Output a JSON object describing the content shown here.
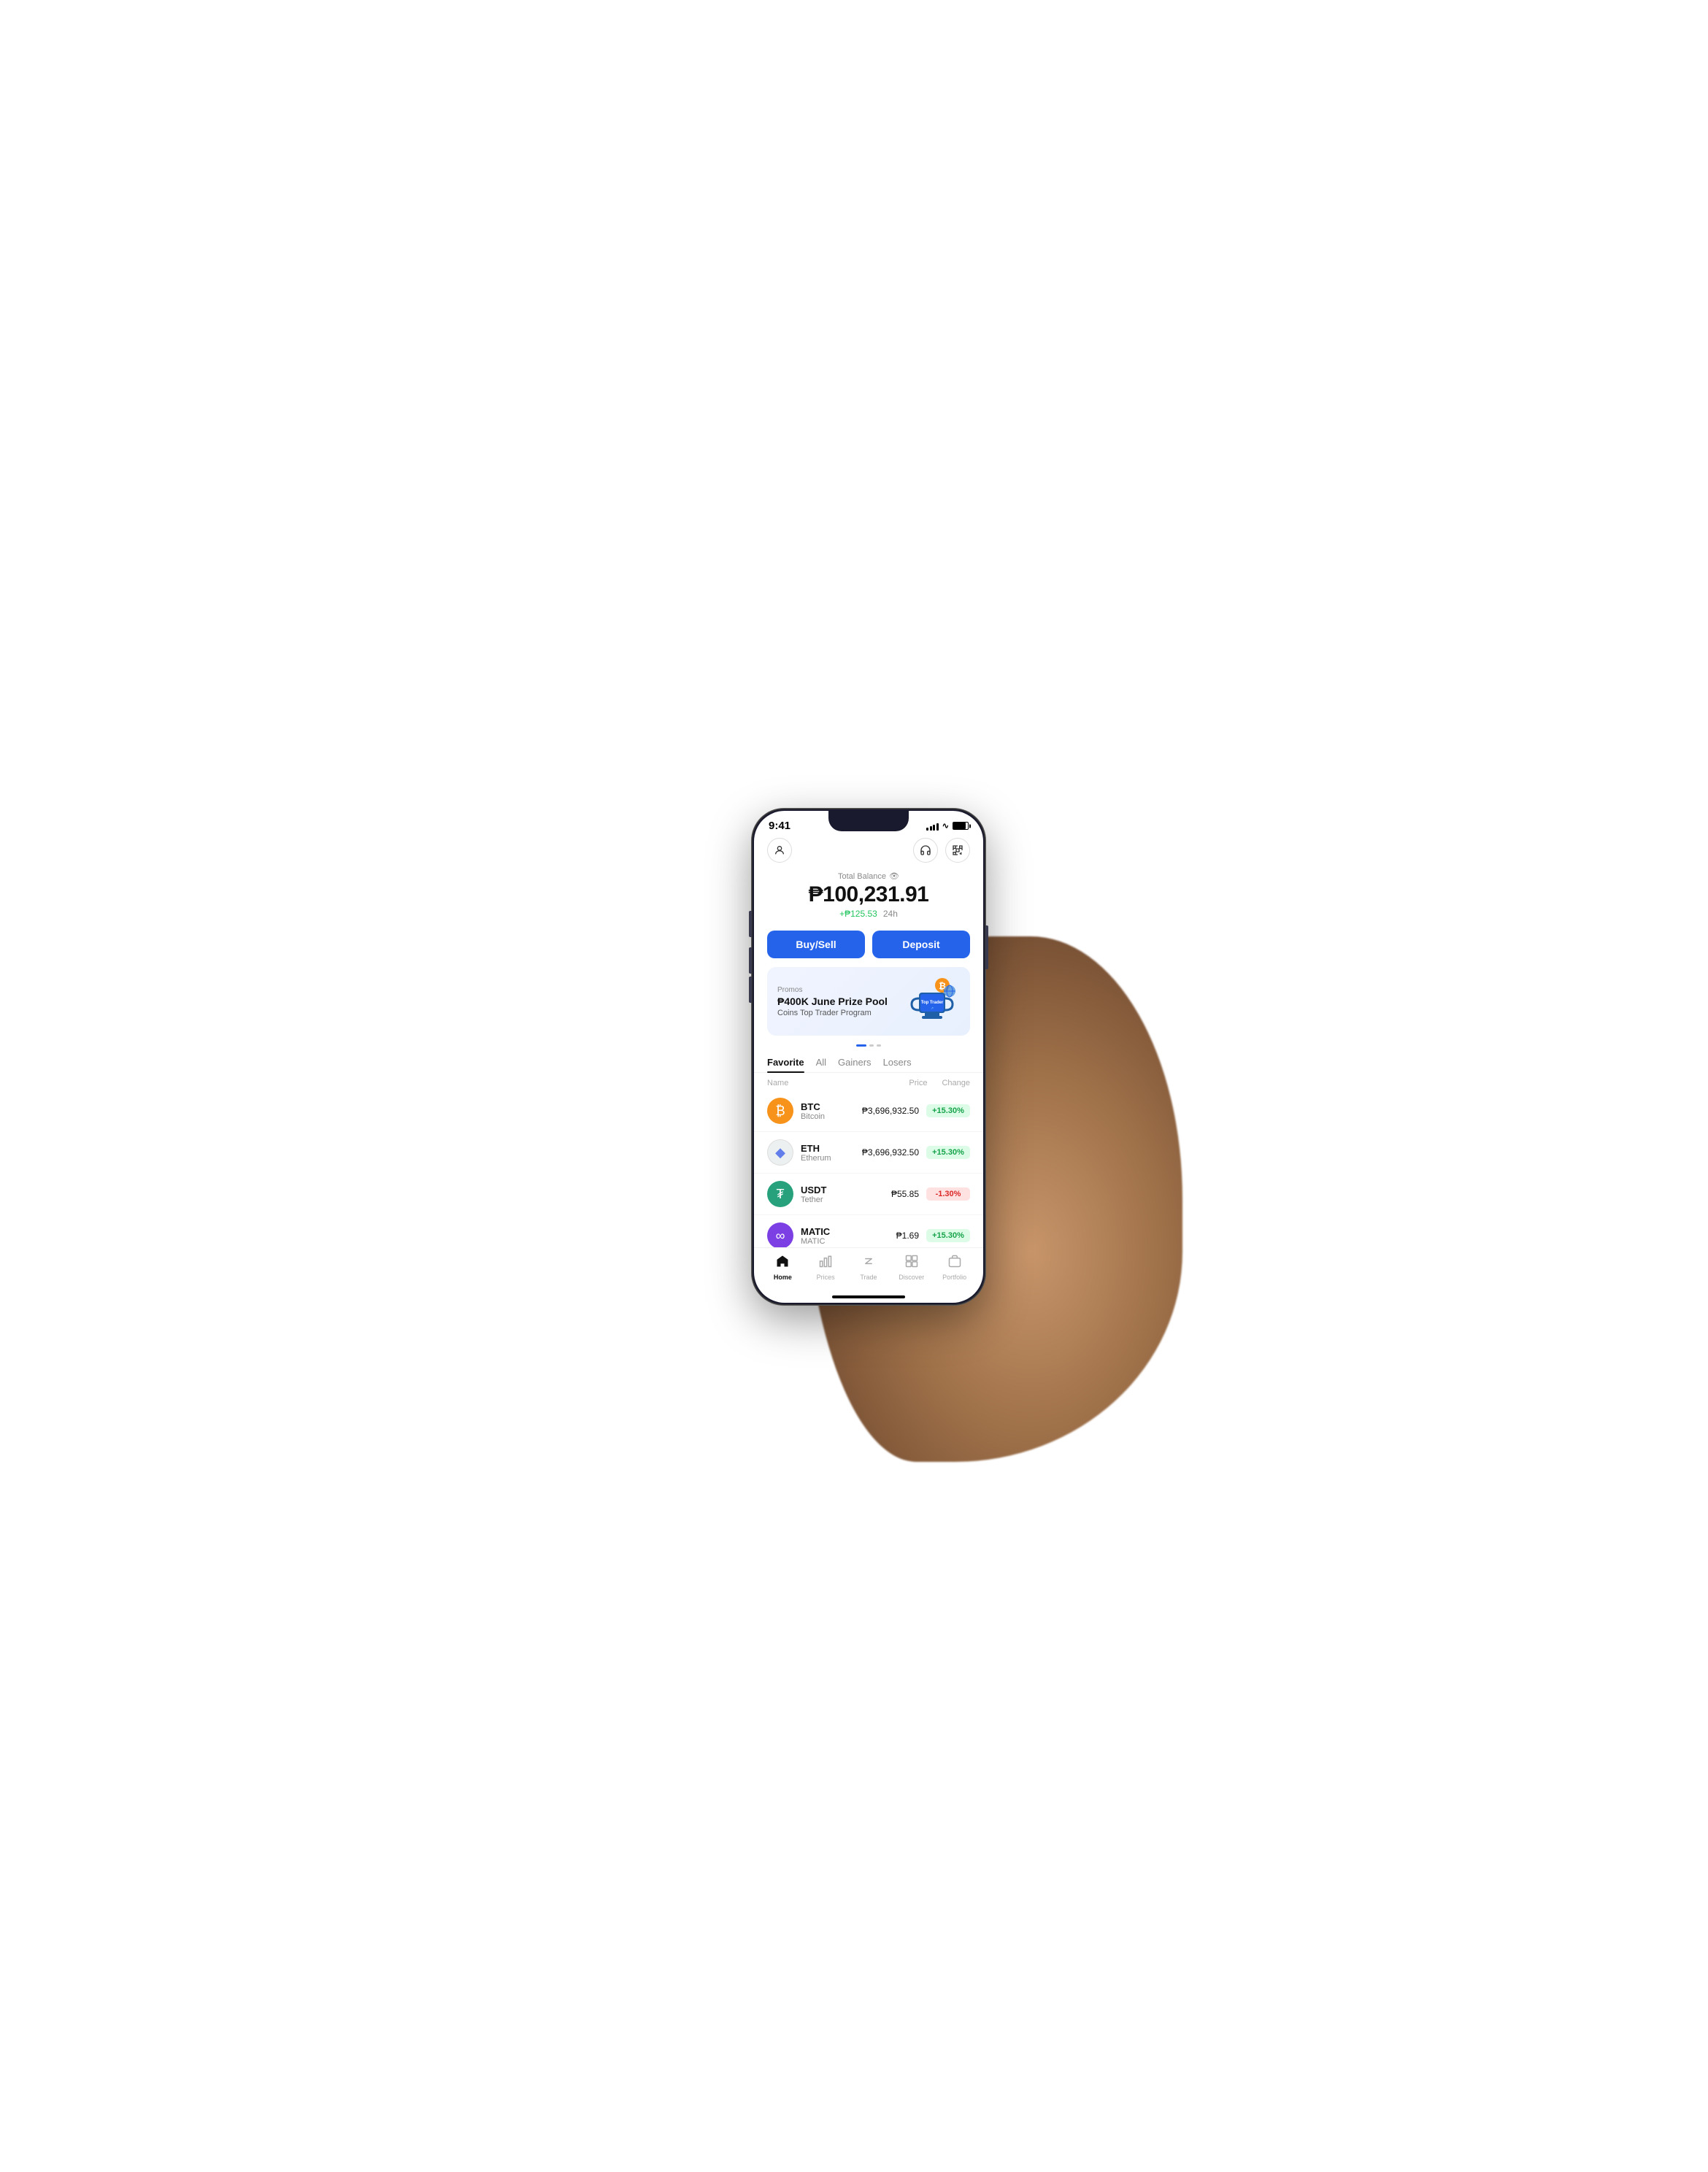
{
  "status_bar": {
    "time": "9:41",
    "signal": 4,
    "wifi": true,
    "battery": 100
  },
  "header": {
    "total_balance_label": "Total Balance",
    "balance_amount": "₱100,231.91",
    "balance_change": "+₱125.53",
    "balance_period": "24h",
    "support_icon": "headphone-icon",
    "scan_icon": "scan-icon",
    "profile_icon": "profile-icon"
  },
  "actions": {
    "buy_sell_label": "Buy/Sell",
    "deposit_label": "Deposit"
  },
  "promo": {
    "tag": "Promos",
    "title": "₱400K June Prize Pool",
    "subtitle": "Coins Top Trader Program",
    "badge": "Top Trader ↗"
  },
  "market_tabs": {
    "tabs": [
      "Favorite",
      "All",
      "Gainers",
      "Losers"
    ],
    "active": "Favorite"
  },
  "table_headers": {
    "name": "Name",
    "price": "Price",
    "change": "Change"
  },
  "coins": [
    {
      "symbol": "BTC",
      "name": "Bitcoin",
      "price": "₱3,696,932.50",
      "change": "+15.30%",
      "positive": true,
      "icon": "btc"
    },
    {
      "symbol": "ETH",
      "name": "Etherum",
      "price": "₱3,696,932.50",
      "change": "+15.30%",
      "positive": true,
      "icon": "eth"
    },
    {
      "symbol": "USDT",
      "name": "Tether",
      "price": "₱55.85",
      "change": "-1.30%",
      "positive": false,
      "icon": "usdt"
    },
    {
      "symbol": "MATIC",
      "name": "MATIC",
      "price": "₱1.69",
      "change": "+15.30%",
      "positive": true,
      "icon": "matic"
    }
  ],
  "bottom_nav": {
    "items": [
      {
        "label": "Home",
        "icon": "home-icon",
        "active": true
      },
      {
        "label": "Prices",
        "icon": "prices-icon",
        "active": false
      },
      {
        "label": "Trade",
        "icon": "trade-icon",
        "active": false
      },
      {
        "label": "Discover",
        "icon": "discover-icon",
        "active": false
      },
      {
        "label": "Portfolio",
        "icon": "portfolio-icon",
        "active": false
      }
    ]
  }
}
